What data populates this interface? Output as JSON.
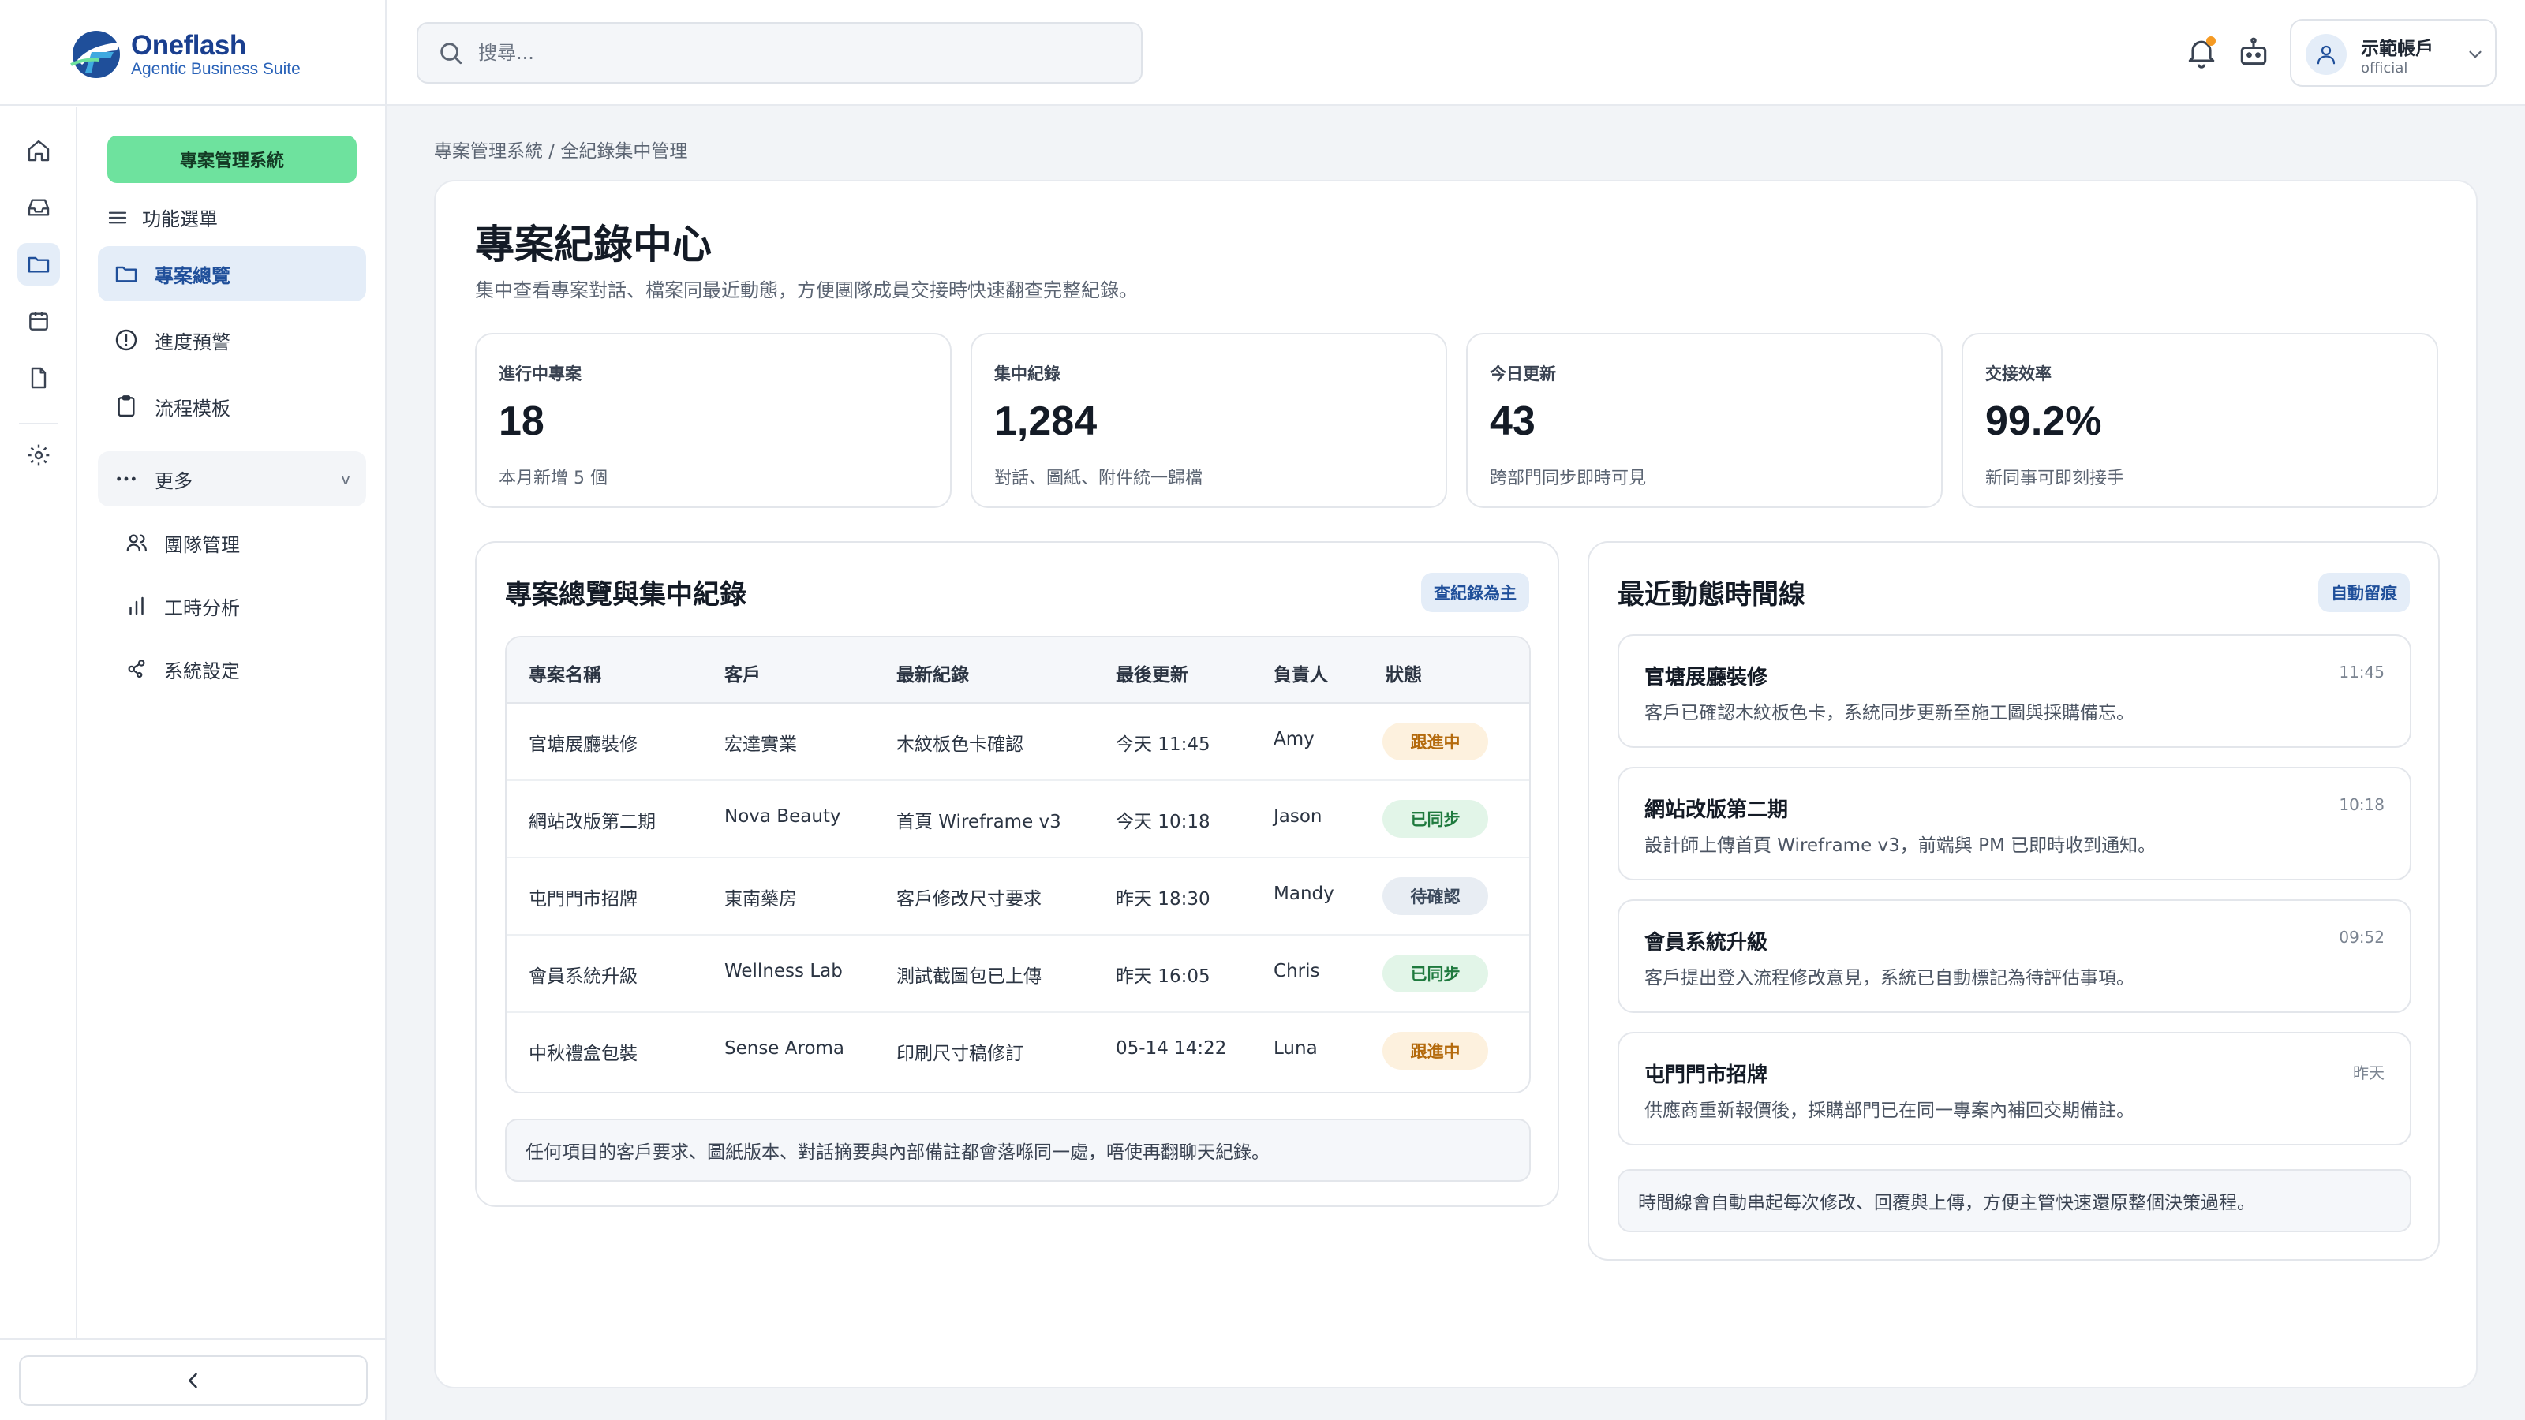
{
  "brand": {
    "name": "Oneflash",
    "tagline": "Agentic Business Suite"
  },
  "search": {
    "placeholder": "搜尋..."
  },
  "account": {
    "name": "示範帳戶",
    "role": "official"
  },
  "sidebar": {
    "system_label": "專案管理系統",
    "menu_title": "功能選單",
    "items": [
      {
        "label": "專案總覽",
        "icon": "folder-icon"
      },
      {
        "label": "進度預警",
        "icon": "alert-circle-icon"
      },
      {
        "label": "流程模板",
        "icon": "clipboard-icon"
      },
      {
        "label": "更多",
        "icon": "dots-icon"
      }
    ],
    "sub_items": [
      {
        "label": "團隊管理",
        "icon": "users-icon"
      },
      {
        "label": "工時分析",
        "icon": "bar-chart-icon"
      },
      {
        "label": "系統設定",
        "icon": "settings-nodes-icon"
      }
    ],
    "more_caret": "v"
  },
  "breadcrumb": "專案管理系統 / 全紀錄集中管理",
  "page": {
    "title": "專案紀錄中心",
    "description": "集中查看專案對話、檔案同最近動態，方便團隊成員交接時快速翻查完整紀錄。"
  },
  "stats": [
    {
      "label": "進行中專案",
      "value": "18",
      "note": "本月新增 5 個"
    },
    {
      "label": "集中紀錄",
      "value": "1,284",
      "note": "對話、圖紙、附件統一歸檔"
    },
    {
      "label": "今日更新",
      "value": "43",
      "note": "跨部門同步即時可見"
    },
    {
      "label": "交接效率",
      "value": "99.2%",
      "note": "新同事可即刻接手"
    }
  ],
  "overview": {
    "title": "專案總覽與集中紀錄",
    "tag": "查紀錄為主",
    "columns": [
      "專案名稱",
      "客戶",
      "最新紀錄",
      "最後更新",
      "負責人",
      "狀態"
    ],
    "rows": [
      {
        "project": "官塘展廳裝修",
        "client": "宏達實業",
        "latest": "木紋板色卡確認",
        "updated": "今天 11:45",
        "owner": "Amy",
        "status": "跟進中",
        "status_key": "follow"
      },
      {
        "project": "網站改版第二期",
        "client": "Nova Beauty",
        "latest": "首頁 Wireframe v3",
        "updated": "今天 10:18",
        "owner": "Jason",
        "status": "已同步",
        "status_key": "synced"
      },
      {
        "project": "屯門門市招牌",
        "client": "東南藥房",
        "latest": "客戶修改尺寸要求",
        "updated": "昨天 18:30",
        "owner": "Mandy",
        "status": "待確認",
        "status_key": "pending"
      },
      {
        "project": "會員系統升級",
        "client": "Wellness Lab",
        "latest": "測試截圖包已上傳",
        "updated": "昨天 16:05",
        "owner": "Chris",
        "status": "已同步",
        "status_key": "synced"
      },
      {
        "project": "中秋禮盒包裝",
        "client": "Sense Aroma",
        "latest": "印刷尺寸稿修訂",
        "updated": "05-14 14:22",
        "owner": "Luna",
        "status": "跟進中",
        "status_key": "follow"
      }
    ],
    "footer_note": "任何項目的客戶要求、圖紙版本、對話摘要與內部備註都會落喺同一處，唔使再翻聊天紀錄。"
  },
  "timeline": {
    "title": "最近動態時間線",
    "tag": "自動留痕",
    "events": [
      {
        "title": "官塘展廳裝修",
        "time": "11:45",
        "desc": "客戶已確認木紋板色卡，系統同步更新至施工圖與採購備忘。"
      },
      {
        "title": "網站改版第二期",
        "time": "10:18",
        "desc": "設計師上傳首頁 Wireframe v3，前端與 PM 已即時收到通知。"
      },
      {
        "title": "會員系統升級",
        "time": "09:52",
        "desc": "客戶提出登入流程修改意見，系統已自動標記為待評估事項。"
      },
      {
        "title": "屯門門市招牌",
        "time": "昨天",
        "desc": "供應商重新報價後，採購部門已在同一專案內補回交期備註。"
      }
    ],
    "footer_note": "時間線會自動串起每次修改、回覆與上傳，方便主管快速還原整個決策過程。"
  },
  "colors": {
    "accent": "#1f4f9a",
    "brand_blue": "#1a3f8f",
    "system_green": "#6ee29e",
    "status_follow_bg": "#fdf1de",
    "status_follow_fg": "#b46a0c",
    "status_synced_bg": "#e2f5e8",
    "status_synced_fg": "#1f7a3e",
    "status_pending_bg": "#e8edf3",
    "status_pending_fg": "#3c4a5d"
  }
}
